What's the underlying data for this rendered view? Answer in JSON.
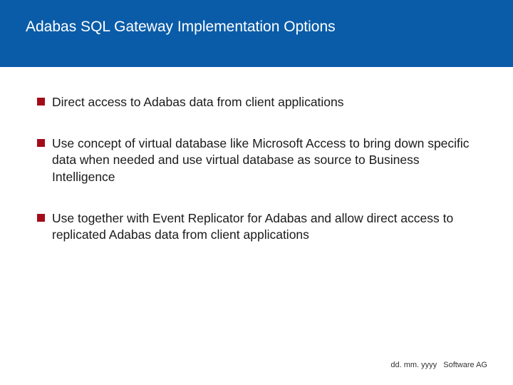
{
  "title": "Adabas SQL Gateway Implementation Options",
  "bullets": [
    {
      "text": "Direct access to Adabas data from client applications"
    },
    {
      "text": "Use concept of virtual database like Microsoft Access to bring down specific data when needed and use virtual database as source to Business Intelligence"
    },
    {
      "text": "Use together with Event Replicator for Adabas and allow direct access to replicated Adabas data from client applications"
    }
  ],
  "footer": {
    "date": "dd. mm. yyyy",
    "company": "Software AG"
  },
  "colors": {
    "title_bg": "#0a5ca8",
    "bullet_marker": "#a30b1a"
  }
}
